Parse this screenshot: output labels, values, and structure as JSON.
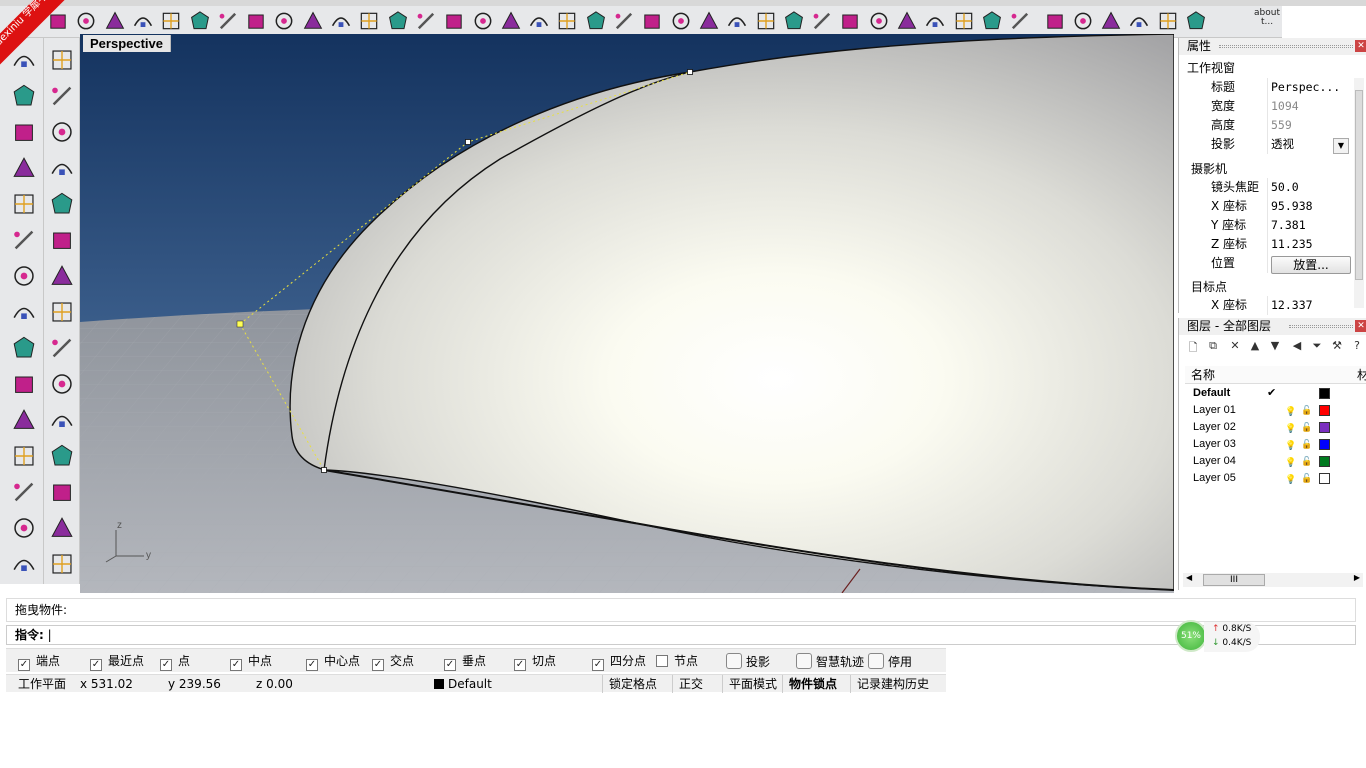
{
  "watermark": "xuexiniu\n学犀牛中文网",
  "toolbar": {
    "icons": [
      "box-icon",
      "box-wire-icon",
      "shaded-box-icon",
      "curve-edit-icon",
      "shape-icon",
      "grid-points-icon",
      "rotate-icon",
      "polygon-icon",
      "surface-icon",
      "arch-icon",
      "drape-icon",
      "loft-icon",
      "extrude-icon",
      "array-icon",
      "check-icon",
      "blend-icon",
      "cage-icon",
      "bend-icon",
      "wave-icon",
      "twist-icon",
      "mirror-icon",
      "shear-icon",
      "flow-icon",
      "taper-icon",
      "stretch-icon",
      "star-icon",
      "orient-icon",
      "plane-icon",
      "snap-icon",
      "section-icon",
      "trim-icon",
      "sphere-black-icon",
      "points-icon",
      "tree-icon",
      "gear-icon",
      "dots-grid-icon",
      "grid-icon",
      "table-icon",
      "dotted-grid-icon",
      "red-grid-icon",
      "diamond-icon"
    ],
    "about": "about\nt..."
  },
  "left_toolbar": {
    "icons": [
      "select-arrow-icon",
      "point-icon",
      "polyline-icon",
      "curve-icon",
      "circle-icon",
      "ellipse-icon",
      "arc-icon",
      "rectangle-icon",
      "polygon-icon",
      "fillet-icon",
      "surface-icon",
      "patch-icon",
      "box-solid-icon",
      "sphere-icon",
      "cylinder-icon",
      "freeform-surface-icon",
      "plugin-icon",
      "explode-icon",
      "split-icon",
      "join-icon",
      "boolean-icon",
      "mesh-icon",
      "offset-icon",
      "rebuild-icon",
      "text-icon",
      "move-icon",
      "group-icon",
      "transform-icon",
      "block-icon",
      "gumball-icon"
    ]
  },
  "viewport": {
    "title": "Perspective",
    "axis_z": "z",
    "axis_y": "y"
  },
  "properties": {
    "title": "属性",
    "section_viewport": "工作视窗",
    "rows": [
      {
        "key": "标题",
        "value": "Perspec..."
      },
      {
        "key": "宽度",
        "value": "1094"
      },
      {
        "key": "高度",
        "value": "559"
      },
      {
        "key": "投影",
        "value": "透视"
      }
    ],
    "section_camera": "摄影机",
    "camera_rows": [
      {
        "key": "镜头焦距",
        "value": "50.0"
      },
      {
        "key": "X 座标",
        "value": "95.938"
      },
      {
        "key": "Y 座标",
        "value": "7.381"
      },
      {
        "key": "Z 座标",
        "value": "11.235"
      },
      {
        "key": "位置",
        "value": ""
      }
    ],
    "place_button": "放置...",
    "section_target": "目标点",
    "target_rows": [
      {
        "key": "X 座标",
        "value": "12.337"
      }
    ]
  },
  "layers": {
    "title": "图层 - 全部图层",
    "column_name": "名称",
    "column_material": "材",
    "items": [
      {
        "name": "Default",
        "current": true,
        "check": "✔",
        "color": "#000000"
      },
      {
        "name": "Layer 01",
        "current": false,
        "color": "#ff0000"
      },
      {
        "name": "Layer 02",
        "current": false,
        "color": "#7b2fbf"
      },
      {
        "name": "Layer 03",
        "current": false,
        "color": "#0000ff"
      },
      {
        "name": "Layer 04",
        "current": false,
        "color": "#007a1f"
      },
      {
        "name": "Layer 05",
        "current": false,
        "color": "#ffffff"
      }
    ],
    "scroll_label": "III"
  },
  "command": {
    "history": "拖曳物件:",
    "prompt": "指令:"
  },
  "network": {
    "percent": "51%",
    "up": "0.8K/S",
    "down": "0.4K/S"
  },
  "osnaps": [
    {
      "label": "端点",
      "checked": true
    },
    {
      "label": "最近点",
      "checked": true
    },
    {
      "label": "点",
      "checked": true
    },
    {
      "label": "中点",
      "checked": true
    },
    {
      "label": "中心点",
      "checked": true
    },
    {
      "label": "交点",
      "checked": true
    },
    {
      "label": "垂点",
      "checked": true
    },
    {
      "label": "切点",
      "checked": true
    },
    {
      "label": "四分点",
      "checked": true
    },
    {
      "label": "节点",
      "checked": false
    }
  ],
  "toggles": {
    "project": "投影",
    "smart_track": "智慧轨迹",
    "disable": "停用"
  },
  "status": {
    "cplane": "工作平面",
    "x": "x 531.02",
    "y": "y 239.56",
    "z": "z 0.00",
    "layer": "Default",
    "grid_snap": "锁定格点",
    "ortho": "正交",
    "planar": "平面模式",
    "osnap": "物件锁点",
    "history": "记录建构历史"
  },
  "colors": {
    "sky_top": "#1d3f6e",
    "sky_bottom": "#5a7aa1",
    "ground": "#9a9ea6"
  }
}
